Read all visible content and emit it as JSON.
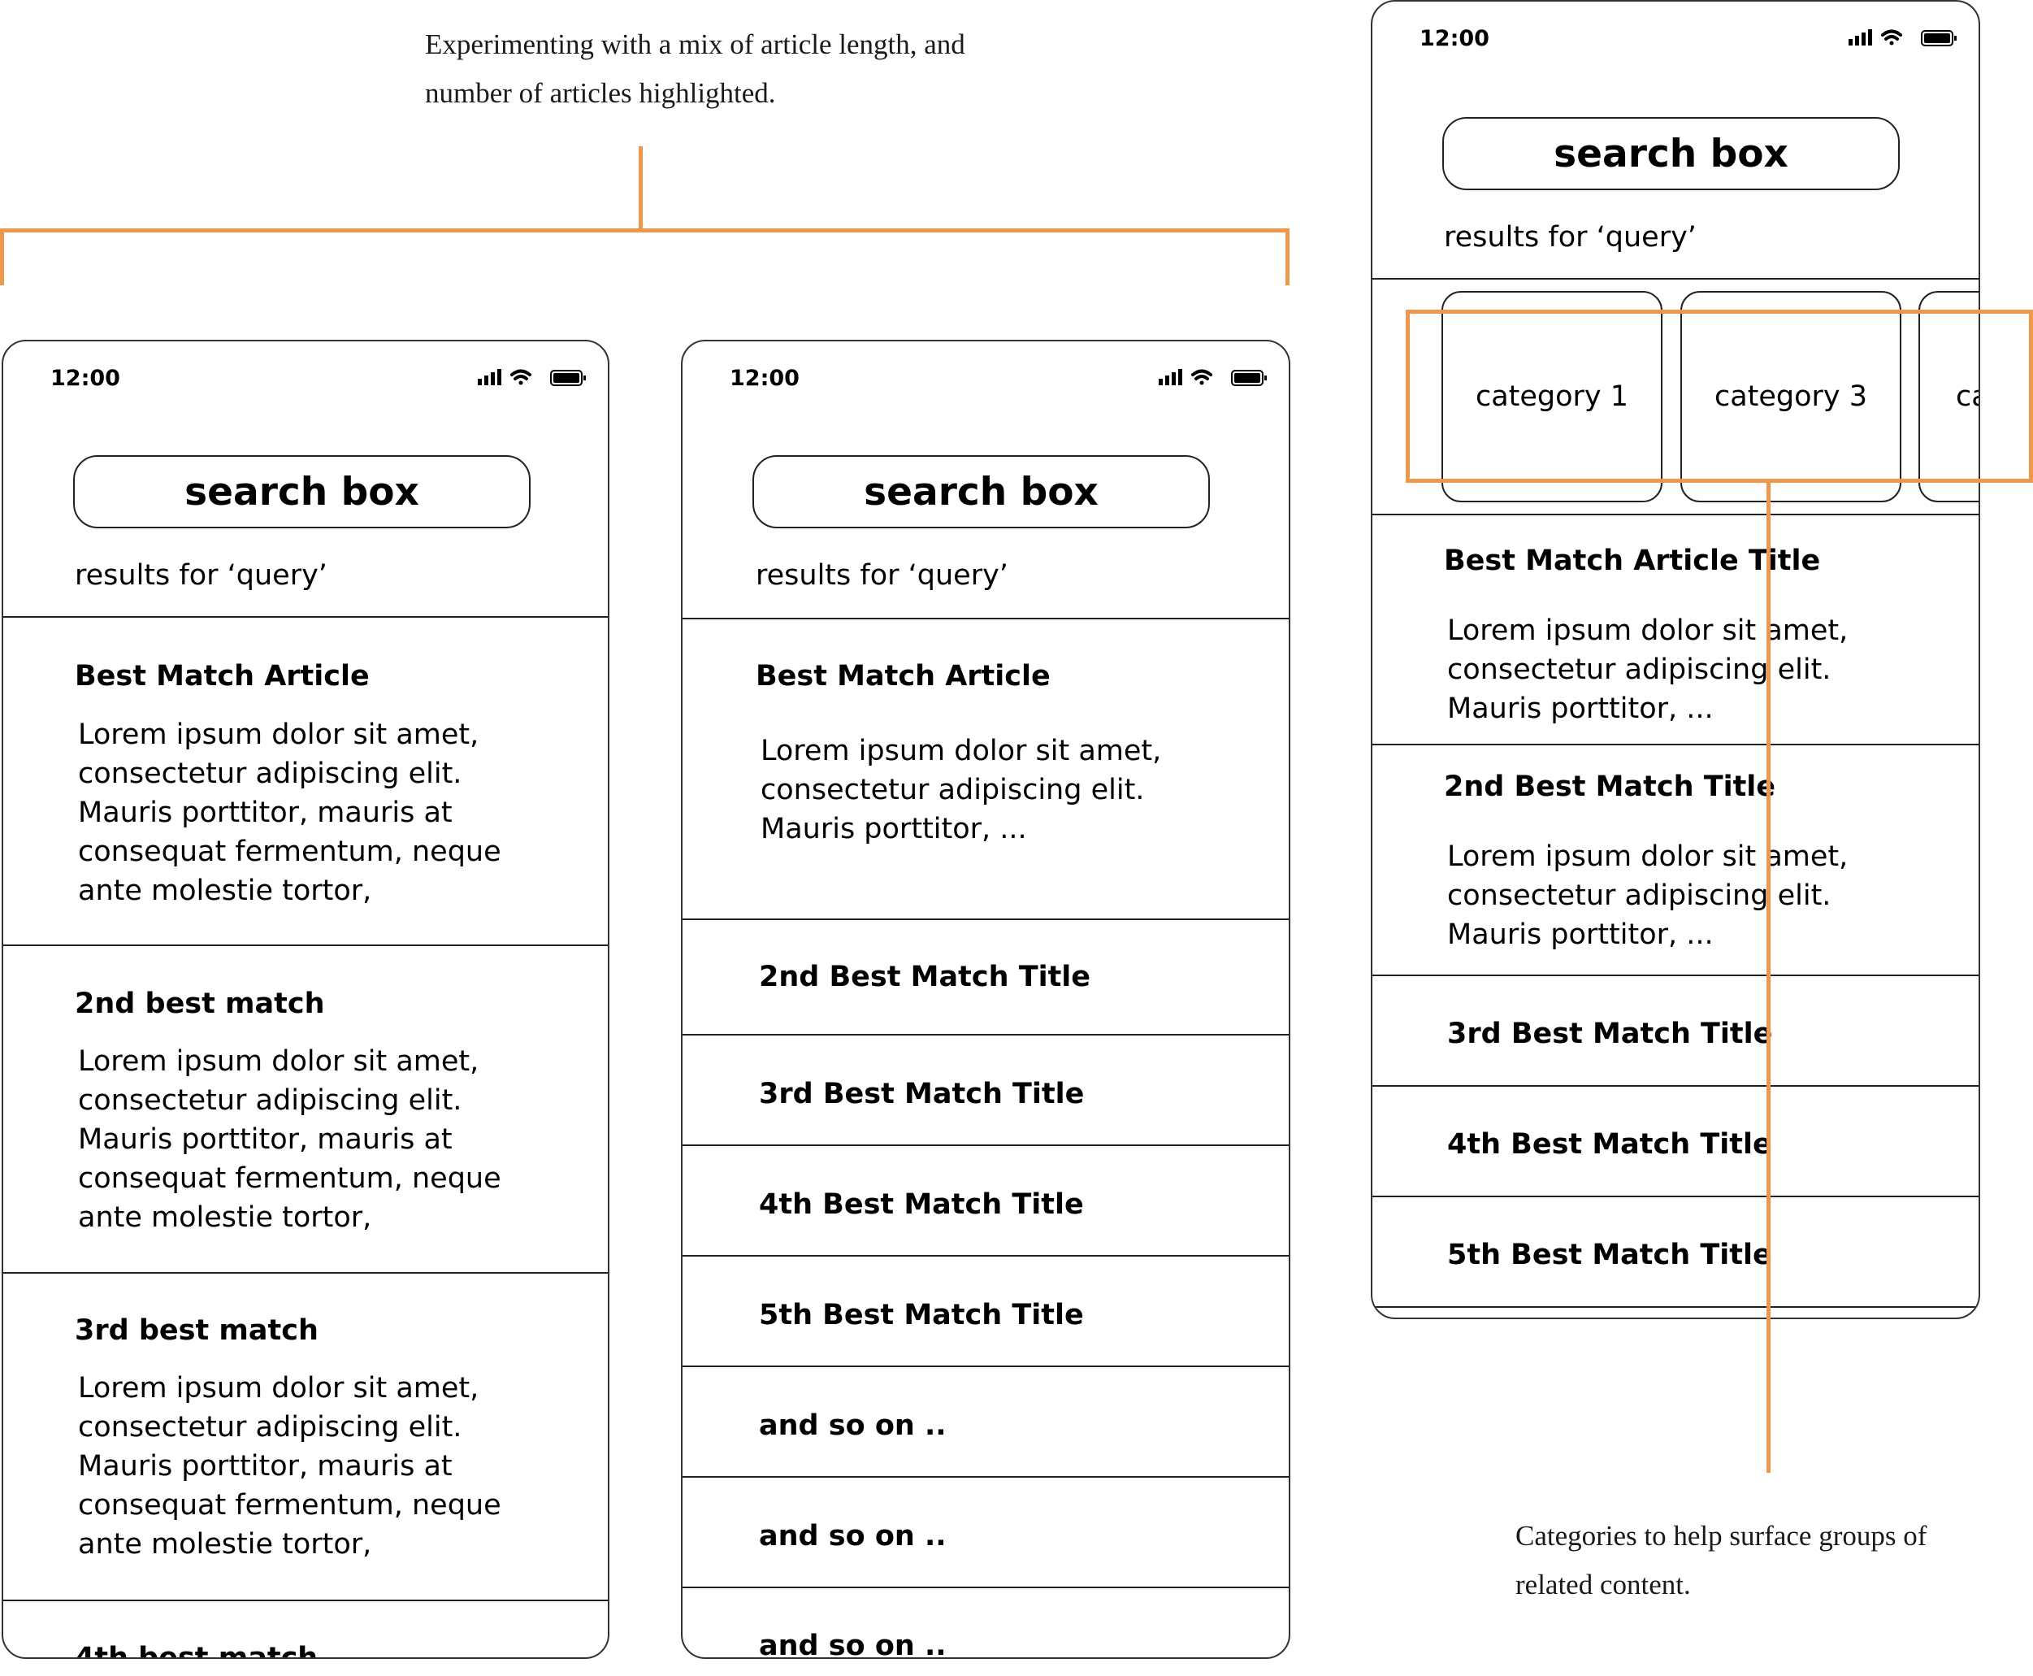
{
  "annotations": {
    "top_note": [
      "Experimenting with a mix of article length, and",
      "number of articles highlighted."
    ],
    "right_note": [
      "Categories to help surface groups of",
      "related content."
    ]
  },
  "colors": {
    "accent": "#f0984a",
    "ink": "#000000"
  },
  "status_bar": {
    "time": "12:00",
    "icons": [
      "signal-icon",
      "wifi-icon",
      "battery-icon"
    ]
  },
  "phone1": {
    "search": "search box",
    "results": "results for ‘query’",
    "articles": [
      {
        "title": "Best Match Article",
        "body": "Lorem ipsum dolor sit amet,\nconsectetur adipiscing elit.\nMauris porttitor, mauris at\nconsequat fermentum, neque\nante molestie tortor,"
      },
      {
        "title": "2nd best match",
        "body": "Lorem ipsum dolor sit amet,\nconsectetur adipiscing elit.\nMauris porttitor, mauris at\nconsequat fermentum, neque\nante molestie tortor,"
      },
      {
        "title": "3rd best match",
        "body": "Lorem ipsum dolor sit amet,\nconsectetur adipiscing elit.\nMauris porttitor, mauris at\nconsequat fermentum, neque\nante molestie tortor,"
      },
      {
        "title": "4th best match"
      }
    ]
  },
  "phone2": {
    "search": "search box",
    "results": "results for ‘query’",
    "best": {
      "title": "Best Match Article",
      "body": "Lorem ipsum dolor sit amet,\nconsectetur adipiscing elit.\nMauris porttitor, ..."
    },
    "titles": [
      "2nd Best Match Title",
      "3rd Best Match Title",
      "4th Best Match Title",
      "5th Best Match Title",
      "and so on ..",
      "and so on ..",
      "and so on .."
    ]
  },
  "phone3": {
    "search": "search box",
    "results": "results for ‘query’",
    "categories": [
      "category 1",
      "category 3",
      "ca"
    ],
    "articles": [
      {
        "title": "Best Match Article Title",
        "body": "Lorem ipsum dolor sit amet,\nconsectetur adipiscing elit.\nMauris porttitor, ..."
      },
      {
        "title": "2nd Best Match Title",
        "body": "Lorem ipsum dolor sit amet,\nconsectetur adipiscing elit.\nMauris porttitor, ..."
      }
    ],
    "titles": [
      "3rd Best Match Title",
      "4th Best Match Title",
      "5th Best Match Title"
    ]
  }
}
